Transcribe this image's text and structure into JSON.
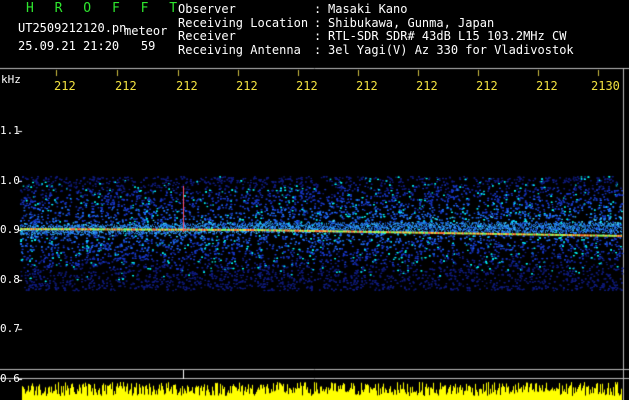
{
  "header": {
    "title": "H R O F F T",
    "filename": "UT2509212120.pn",
    "mode_label": "meteor",
    "timestamp": "25.09.21 21:20",
    "count": "59",
    "fields": [
      {
        "label": "Observer",
        "sep": ":",
        "value": "Masaki Kano"
      },
      {
        "label": "Receiving Location",
        "sep": ":",
        "value": "Shibukawa, Gunma, Japan"
      },
      {
        "label": "Receiver",
        "sep": ":",
        "value": "RTL-SDR SDR# 43dB L15 103.2MHz CW"
      },
      {
        "label": "Receiving Antenna",
        "sep": ":",
        "value": "3el Yagi(V) Az 330 for Vladivostok"
      }
    ]
  },
  "axis": {
    "y_unit": "kHz",
    "x_ticks": [
      "212",
      "212",
      "212",
      "212",
      "212",
      "212",
      "212",
      "212",
      "212",
      "2130"
    ],
    "y_ticks": [
      "1.1",
      "1.0",
      "0.9",
      "0.8",
      "0.7",
      "0.6"
    ]
  },
  "colors": {
    "background": "#000000",
    "title": "#2ee62e",
    "x_tick": "#f0e040",
    "level_bars": "#ffff00",
    "signal_line": "#ff6020",
    "waterfall_low": "#1020a0",
    "waterfall_high": "#40e0ff"
  }
}
